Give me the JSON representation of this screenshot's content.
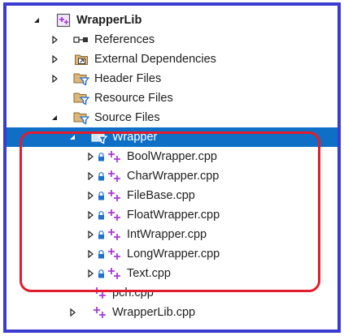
{
  "tree": {
    "root": {
      "label": "WrapperLib",
      "icon": "cpp-project-icon"
    },
    "items": [
      {
        "label": "References",
        "icon": "references-icon"
      },
      {
        "label": "External Dependencies",
        "icon": "external-dependencies-icon"
      },
      {
        "label": "Header Files",
        "icon": "filter-folder-icon"
      },
      {
        "label": "Resource Files",
        "icon": "filter-folder-icon"
      },
      {
        "label": "Source Files",
        "icon": "filter-folder-icon"
      },
      {
        "label": "Wrapper",
        "icon": "filter-folder-icon"
      },
      {
        "label": "BoolWrapper.cpp",
        "icon": "cpp-file-icon"
      },
      {
        "label": "CharWrapper.cpp",
        "icon": "cpp-file-icon"
      },
      {
        "label": "FileBase.cpp",
        "icon": "cpp-file-icon"
      },
      {
        "label": "FloatWrapper.cpp",
        "icon": "cpp-file-icon"
      },
      {
        "label": "IntWrapper.cpp",
        "icon": "cpp-file-icon"
      },
      {
        "label": "LongWrapper.cpp",
        "icon": "cpp-file-icon"
      },
      {
        "label": "Text.cpp",
        "icon": "cpp-file-icon"
      },
      {
        "label": "pch.cpp",
        "icon": "cpp-file-icon"
      },
      {
        "label": "WrapperLib.cpp",
        "icon": "cpp-file-icon"
      }
    ]
  },
  "colors": {
    "frame_border": "#3a3ccf",
    "selection": "#0f6fc6",
    "highlight_border": "#e31c2d",
    "cpp_icon": "#a83bd6"
  }
}
